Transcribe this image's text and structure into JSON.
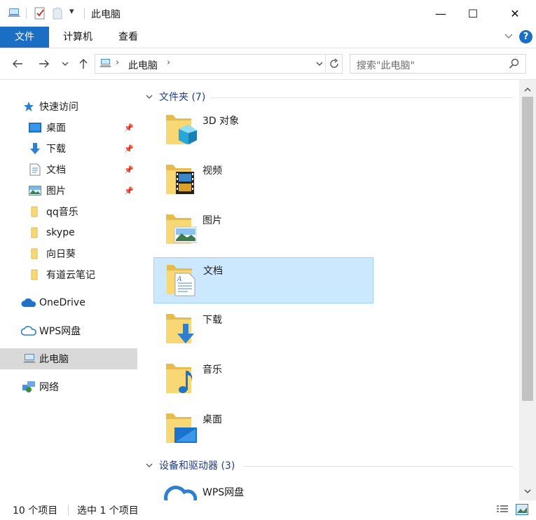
{
  "window": {
    "title": "此电脑",
    "qat_dropdown": "▾",
    "minimize": "—",
    "maximize": "☐",
    "close": "✕"
  },
  "ribbon": {
    "tabs": [
      {
        "label": "文件",
        "active": true
      },
      {
        "label": "计算机",
        "active": false
      },
      {
        "label": "查看",
        "active": false
      }
    ],
    "help": "?"
  },
  "navbar": {
    "address_path": "此电脑",
    "search_placeholder": "搜索\"此电脑\""
  },
  "sidebar": {
    "items": [
      {
        "label": "快速访问",
        "icon": "star-icon"
      },
      {
        "label": "桌面",
        "icon": "desktop-icon",
        "pinned": true
      },
      {
        "label": "下载",
        "icon": "download-icon",
        "pinned": true
      },
      {
        "label": "文档",
        "icon": "document-icon",
        "pinned": true
      },
      {
        "label": "图片",
        "icon": "picture-icon",
        "pinned": true
      },
      {
        "label": "qq音乐",
        "icon": "folder-icon"
      },
      {
        "label": "skype",
        "icon": "folder-icon"
      },
      {
        "label": "向日葵",
        "icon": "folder-icon"
      },
      {
        "label": "有道云笔记",
        "icon": "folder-icon"
      },
      {
        "label": "OneDrive",
        "icon": "cloud-icon"
      },
      {
        "label": "WPS网盘",
        "icon": "cloud-outline-icon"
      },
      {
        "label": "此电脑",
        "icon": "computer-icon",
        "selected": true
      },
      {
        "label": "网络",
        "icon": "network-icon"
      }
    ]
  },
  "main": {
    "folders_group": "文件夹 (7)",
    "folders": [
      {
        "name": "3D 对象",
        "icon": "3d-objects-folder-icon"
      },
      {
        "name": "视频",
        "icon": "videos-folder-icon"
      },
      {
        "name": "图片",
        "icon": "pictures-folder-icon"
      },
      {
        "name": "文档",
        "icon": "documents-folder-icon",
        "selected": true
      },
      {
        "name": "下载",
        "icon": "downloads-folder-icon"
      },
      {
        "name": "音乐",
        "icon": "music-folder-icon"
      },
      {
        "name": "桌面",
        "icon": "desktop-folder-icon"
      }
    ],
    "devices_group": "设备和驱动器 (3)",
    "devices": [
      {
        "name": "WPS网盘",
        "icon": "wps-cloud-drive-icon"
      }
    ]
  },
  "status": {
    "count": "10 个项目",
    "selection": "选中 1 个项目"
  },
  "colors": {
    "accent": "#1a6fc4",
    "selection_bg": "#cce8ff",
    "selection_border": "#99d1ff",
    "group_header": "#1e3c8c",
    "folder_yellow": "#f8d775"
  }
}
